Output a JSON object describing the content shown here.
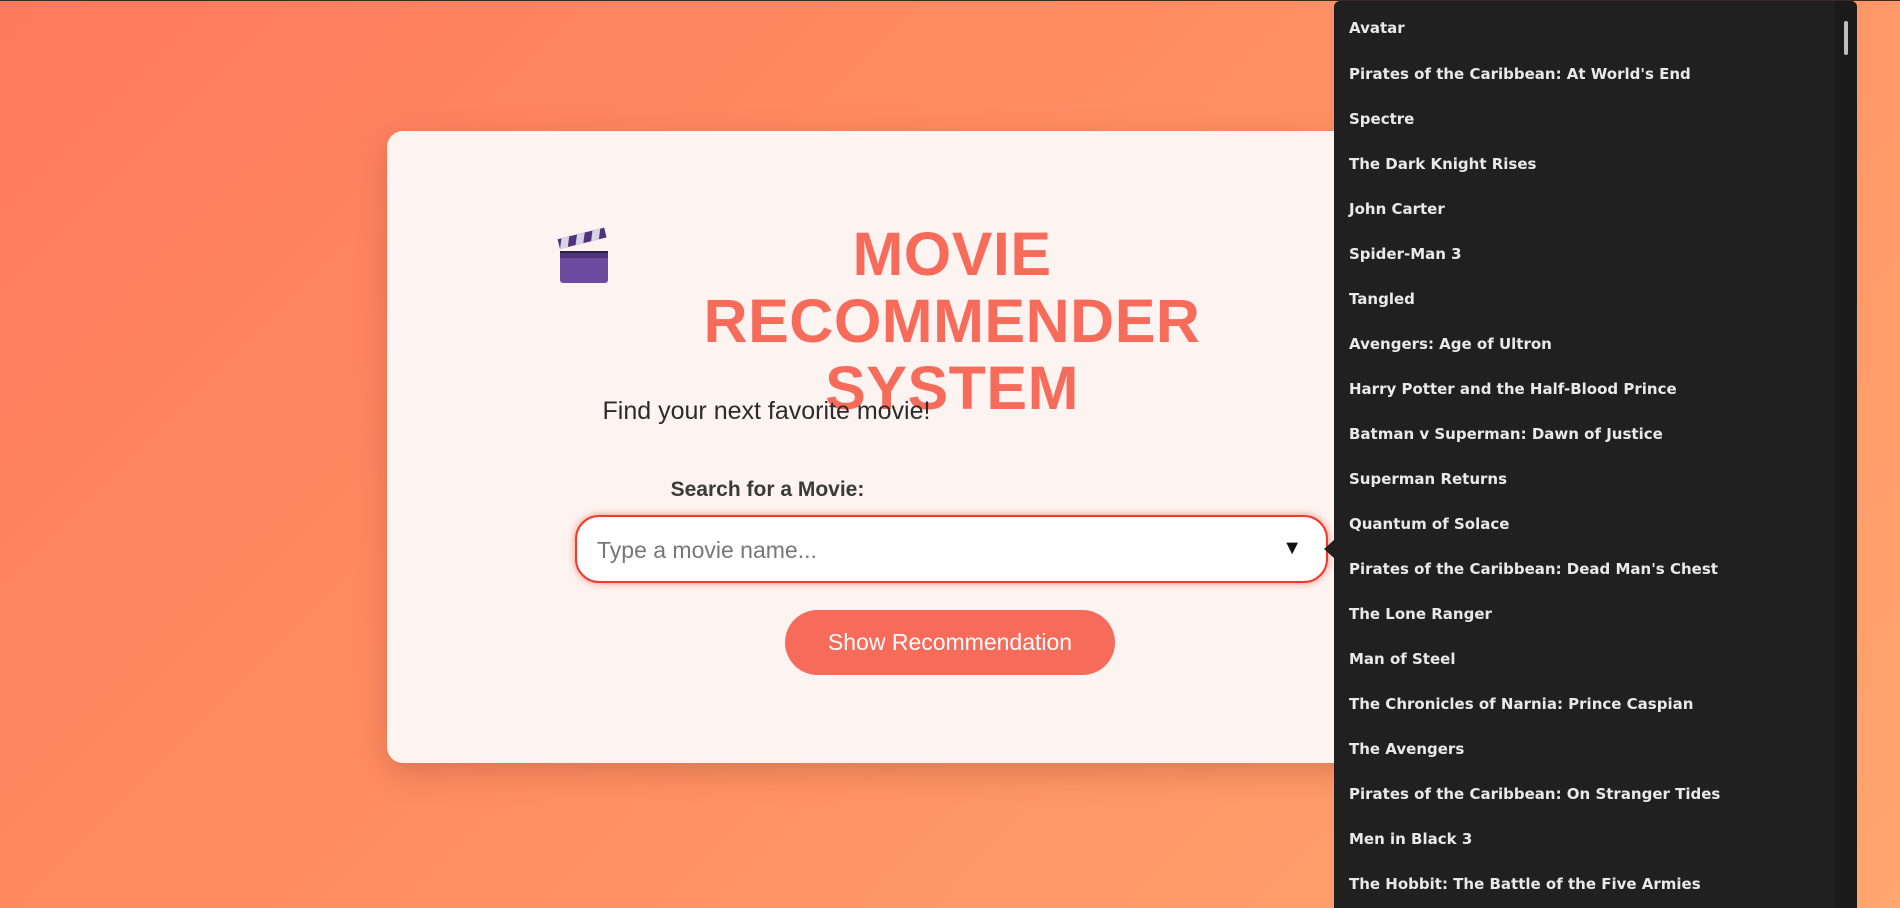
{
  "app": {
    "title": "MOVIE RECOMMENDER SYSTEM",
    "title_icon": "clapperboard-icon",
    "subtitle": "Find your next favorite movie!"
  },
  "search": {
    "label": "Search for a Movie:",
    "value": "",
    "placeholder": "Type a movie name...",
    "dropdown_indicator": "▼"
  },
  "actions": {
    "show_label": "Show Recommendation"
  },
  "dropdown": {
    "options": [
      "Avatar",
      "Pirates of the Caribbean: At World's End",
      "Spectre",
      "The Dark Knight Rises",
      "John Carter",
      "Spider-Man 3",
      "Tangled",
      "Avengers: Age of Ultron",
      "Harry Potter and the Half-Blood Prince",
      "Batman v Superman: Dawn of Justice",
      "Superman Returns",
      "Quantum of Solace",
      "Pirates of the Caribbean: Dead Man's Chest",
      "The Lone Ranger",
      "Man of Steel",
      "The Chronicles of Narnia: Prince Caspian",
      "The Avengers",
      "Pirates of the Caribbean: On Stranger Tides",
      "Men in Black 3",
      "The Hobbit: The Battle of the Five Armies"
    ]
  },
  "colors": {
    "accent": "#f76b5a",
    "background_start": "#ff7a5c",
    "background_end": "#ffa56f",
    "card": "#fdf4f1",
    "dropdown_bg": "#202020",
    "input_border": "#f23b2b"
  }
}
